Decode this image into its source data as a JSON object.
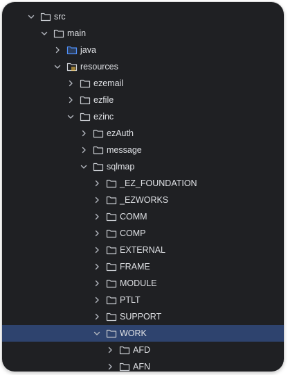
{
  "colors": {
    "panel_bg": "#1f2023",
    "selected_bg": "#2e436e",
    "folder_outline": "#c9ccd1",
    "source_folder": "#4f8ff7",
    "resources_accent": "#e8b846",
    "text": "#dfe1e5"
  },
  "tree": [
    {
      "label": "src",
      "level": 0,
      "expanded": true,
      "icon": "folder-icon"
    },
    {
      "label": "main",
      "level": 1,
      "expanded": true,
      "icon": "folder-icon"
    },
    {
      "label": "java",
      "level": 2,
      "expanded": false,
      "icon": "source-folder-icon"
    },
    {
      "label": "resources",
      "level": 2,
      "expanded": true,
      "icon": "resources-folder-icon"
    },
    {
      "label": "ezemail",
      "level": 3,
      "expanded": false,
      "icon": "folder-icon"
    },
    {
      "label": "ezfile",
      "level": 3,
      "expanded": false,
      "icon": "folder-icon"
    },
    {
      "label": "ezinc",
      "level": 3,
      "expanded": true,
      "icon": "folder-icon"
    },
    {
      "label": "ezAuth",
      "level": 4,
      "expanded": false,
      "icon": "folder-icon"
    },
    {
      "label": "message",
      "level": 4,
      "expanded": false,
      "icon": "folder-icon"
    },
    {
      "label": "sqlmap",
      "level": 4,
      "expanded": true,
      "icon": "folder-icon"
    },
    {
      "label": "_EZ_FOUNDATION",
      "level": 5,
      "expanded": false,
      "icon": "folder-icon"
    },
    {
      "label": "_EZWORKS",
      "level": 5,
      "expanded": false,
      "icon": "folder-icon"
    },
    {
      "label": "COMM",
      "level": 5,
      "expanded": false,
      "icon": "folder-icon"
    },
    {
      "label": "COMP",
      "level": 5,
      "expanded": false,
      "icon": "folder-icon"
    },
    {
      "label": "EXTERNAL",
      "level": 5,
      "expanded": false,
      "icon": "folder-icon"
    },
    {
      "label": "FRAME",
      "level": 5,
      "expanded": false,
      "icon": "folder-icon"
    },
    {
      "label": "MODULE",
      "level": 5,
      "expanded": false,
      "icon": "folder-icon"
    },
    {
      "label": "PTLT",
      "level": 5,
      "expanded": false,
      "icon": "folder-icon"
    },
    {
      "label": "SUPPORT",
      "level": 5,
      "expanded": false,
      "icon": "folder-icon"
    },
    {
      "label": "WORK",
      "level": 5,
      "expanded": true,
      "selected": true,
      "icon": "folder-icon"
    },
    {
      "label": "AFD",
      "level": 6,
      "expanded": false,
      "icon": "folder-icon"
    },
    {
      "label": "AFN",
      "level": 6,
      "expanded": false,
      "icon": "folder-icon"
    }
  ]
}
